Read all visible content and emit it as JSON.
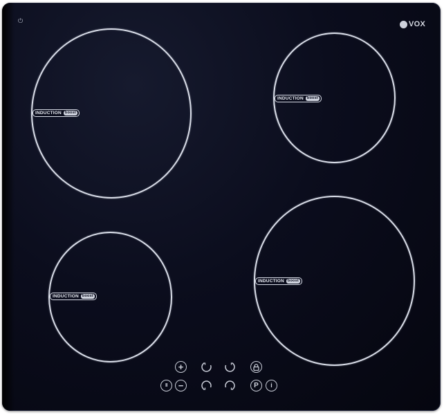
{
  "brand": {
    "logo_text": "VOX"
  },
  "zones": [
    {
      "label": "INDUCTION",
      "boost": "boost"
    },
    {
      "label": "INDUCTION",
      "boost": "boost"
    },
    {
      "label": "INDUCTION",
      "boost": "boost"
    },
    {
      "label": "INDUCTION",
      "boost": "boost"
    }
  ],
  "controls": {
    "plus": "+",
    "minus": "−",
    "pause": "II",
    "lock": "lock-icon",
    "program": "P",
    "info": "i"
  },
  "colors": {
    "glass": "#0b0d1d",
    "ring": "#d9dde8"
  }
}
